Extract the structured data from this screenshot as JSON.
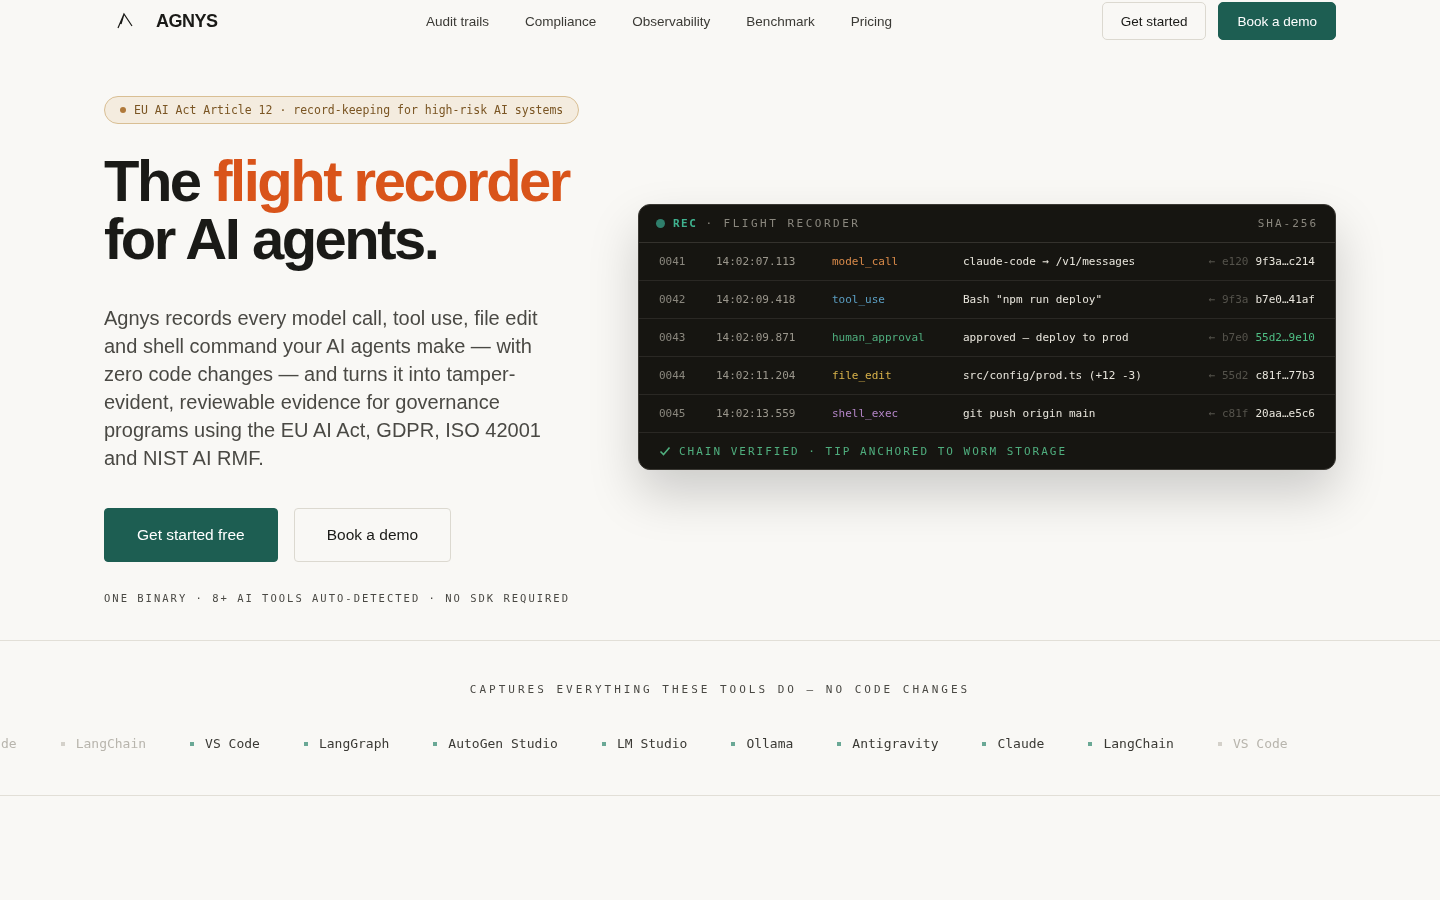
{
  "nav": {
    "brand": "AGNYS",
    "links": [
      "Audit trails",
      "Compliance",
      "Observability",
      "Benchmark",
      "Pricing"
    ],
    "buttons": [
      {
        "label": "Get started",
        "kind": "outline"
      },
      {
        "label": "Book a demo",
        "kind": "primary"
      }
    ]
  },
  "hero": {
    "badge": "EU AI Act Article 12 · record-keeping for high-risk AI systems",
    "title_start": "The",
    "title_accent": "flight recorder",
    "title_end": "for AI agents.",
    "lead": "Agnys records every model call, tool use, file edit and shell command your AI agents make — with zero code changes — and turns it into tamper-evident, reviewable evidence for governance programs using the EU AI Act, GDPR, ISO 42001 and NIST AI RMF.",
    "buttons": [
      {
        "label": "Get started free",
        "kind": "primary"
      },
      {
        "label": "Book a demo",
        "kind": "outline"
      }
    ],
    "footnote": "ONE BINARY · 8+ AI TOOLS AUTO-DETECTED · NO SDK REQUIRED"
  },
  "recorder": {
    "rec": "REC",
    "title": "· FLIGHT RECORDER",
    "hash_label": "SHA-256",
    "rows": [
      {
        "seq": "0041",
        "time": "14:02:07.113",
        "event": "model_call",
        "color": "#d98a4a",
        "detail": "claude-code → /v1/messages",
        "prev": "← e120",
        "hash": "9f3a…c214",
        "highlighted": false
      },
      {
        "seq": "0042",
        "time": "14:02:09.418",
        "event": "tool_use",
        "color": "#5b9fc4",
        "detail": "Bash \"npm run deploy\"",
        "prev": "← 9f3a",
        "hash": "b7e0…41af",
        "highlighted": false
      },
      {
        "seq": "0043",
        "time": "14:02:09.871",
        "event": "human_approval",
        "color": "#4fae7e",
        "detail": "approved — deploy to prod",
        "prev": "← b7e0",
        "hash": "55d2…9e10",
        "highlighted": true
      },
      {
        "seq": "0044",
        "time": "14:02:11.204",
        "event": "file_edit",
        "color": "#d8b24a",
        "detail": "src/config/prod.ts (+12 -3)",
        "prev": "← 55d2",
        "hash": "c81f…77b3",
        "highlighted": false
      },
      {
        "seq": "0045",
        "time": "14:02:13.559",
        "event": "shell_exec",
        "color": "#b486c8",
        "detail": "git push origin main",
        "prev": "← c81f",
        "hash": "20aa…e5c6",
        "highlighted": false
      }
    ],
    "footer": "CHAIN VERIFIED · TIP ANCHORED TO WORM STORAGE"
  },
  "tools": {
    "heading": "CAPTURES EVERYTHING THESE TOOLS DO — NO CODE CHANGES",
    "items": [
      {
        "name": "de",
        "faded": true
      },
      {
        "name": "LangChain",
        "faded": true
      },
      {
        "name": "VS Code",
        "faded": false
      },
      {
        "name": "LangGraph",
        "faded": false
      },
      {
        "name": "AutoGen Studio",
        "faded": false
      },
      {
        "name": "LM Studio",
        "faded": false
      },
      {
        "name": "Ollama",
        "faded": false
      },
      {
        "name": "Antigravity",
        "faded": false
      },
      {
        "name": "Claude",
        "faded": false
      },
      {
        "name": "LangChain",
        "faded": false
      },
      {
        "name": "VS Code",
        "faded": true
      }
    ]
  }
}
